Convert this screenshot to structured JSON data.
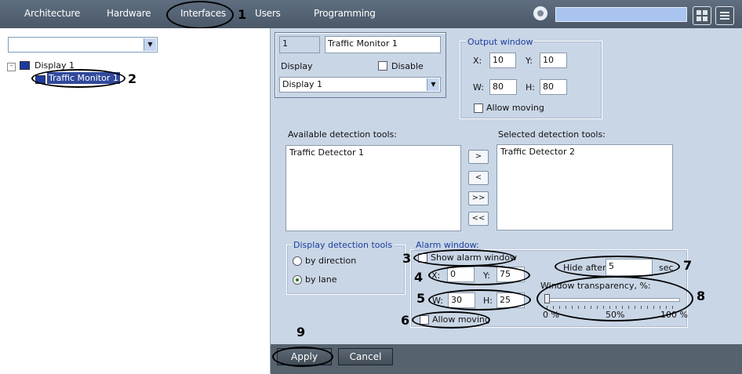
{
  "tabs": [
    "Architecture",
    "Hardware",
    "Interfaces",
    "Users",
    "Programming"
  ],
  "tree": {
    "root": "Display 1",
    "child": "Traffic Monitor 1"
  },
  "form": {
    "id": "1",
    "name": "Traffic Monitor 1",
    "display_label": "Display",
    "disable_label": "Disable",
    "display_value": "Display 1",
    "output_window": {
      "title": "Output window",
      "x_label": "X:",
      "x": "10",
      "y_label": "Y:",
      "y": "10",
      "w_label": "W:",
      "w": "80",
      "h_label": "H:",
      "h": "80",
      "allow_moving": "Allow moving"
    },
    "available_label": "Available detection tools:",
    "available": [
      "Traffic Detector 1"
    ],
    "selected_label": "Selected detection tools:",
    "selected": [
      "Traffic Detector 2"
    ],
    "move_buttons": [
      ">",
      "<",
      ">>",
      "<<"
    ],
    "display_tools": {
      "title": "Display detection tools",
      "by_direction": "by direction",
      "by_lane": "by lane"
    },
    "alarm": {
      "title": "Alarm window:",
      "show": "Show alarm window",
      "x_label": "X:",
      "x": "0",
      "y_label": "Y:",
      "y": "75",
      "w_label": "W:",
      "w": "30",
      "h_label": "H:",
      "h": "25",
      "allow_moving": "Allow moving",
      "hide_after": "Hide after",
      "hide_value": "5",
      "sec": "sec",
      "transparency_label": "Window transparency, %:",
      "t_min": "0 %",
      "t_mid": "50%",
      "t_max": "100 %",
      "transparency": 0
    }
  },
  "buttons": {
    "apply": "Apply",
    "cancel": "Cancel"
  },
  "annotations": [
    "1",
    "2",
    "3",
    "4",
    "5",
    "6",
    "7",
    "8",
    "9"
  ],
  "colors": {
    "panel": "#c9d6e6",
    "topbar": "#56636f",
    "group_title": "#1d3e9c"
  }
}
